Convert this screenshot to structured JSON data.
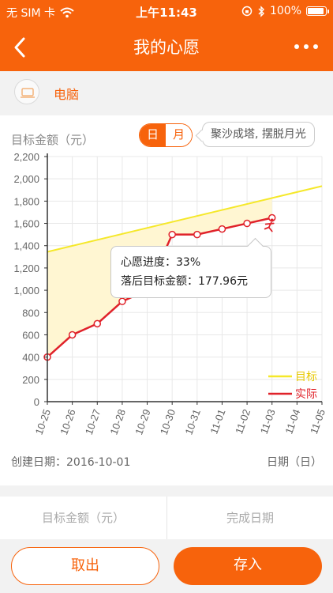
{
  "status": {
    "carrier": "无 SIM 卡",
    "time": "上午11:43",
    "battery": "100%"
  },
  "nav": {
    "title": "我的心愿"
  },
  "category": {
    "label": "电脑"
  },
  "chart_header": {
    "y_title": "目标金额（元）",
    "toggle_day": "日",
    "toggle_month": "月",
    "slogan": "聚沙成塔, 摆脱月光"
  },
  "tooltip": {
    "progress": "心愿进度：33%",
    "behind": "落后目标金额：177.96元"
  },
  "footer": {
    "created": "创建日期：2016-10-01",
    "x_title": "日期（日）"
  },
  "form": {
    "target_amount": "目标金额（元）",
    "finish_date": "完成日期"
  },
  "buttons": {
    "cancel": "取出",
    "save": "存入"
  },
  "chart_data": {
    "type": "line",
    "x": [
      "10-25",
      "10-26",
      "10-27",
      "10-28",
      "10-29",
      "10-30",
      "10-31",
      "11-01",
      "11-02",
      "11-03",
      "11-04",
      "11-05"
    ],
    "yticks": [
      "0",
      "200",
      "400",
      "600",
      "800",
      "1,000",
      "1,200",
      "1,400",
      "1,600",
      "1,800",
      "2,000",
      "2,200"
    ],
    "ylim": [
      0,
      2200
    ],
    "series": [
      {
        "name": "目标",
        "color": "#f5e82a",
        "start": [
          "10-25",
          1345
        ],
        "end": [
          "11-05",
          1935
        ]
      },
      {
        "name": "实际",
        "color": "#e0222a",
        "values": [
          400,
          600,
          700,
          900,
          1000,
          1500,
          1500,
          1550,
          1600,
          1650
        ]
      }
    ],
    "fill_color": "#fff6d2",
    "grid": true,
    "legend": "bottom-right"
  }
}
